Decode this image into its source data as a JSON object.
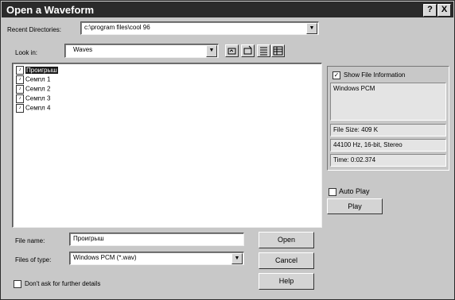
{
  "window": {
    "title": "Open a Waveform",
    "help_btn": "?",
    "close_btn": "X"
  },
  "recent": {
    "label": "Recent Directories:",
    "value": "c:\\program files\\cool 96"
  },
  "lookin": {
    "label": "Look in:",
    "value": "Waves"
  },
  "files": [
    {
      "name": "Проигрыш",
      "selected": true
    },
    {
      "name": "Семпл 1",
      "selected": false
    },
    {
      "name": "Семпл 2",
      "selected": false
    },
    {
      "name": "Семпл 3",
      "selected": false
    },
    {
      "name": "Семпл 4",
      "selected": false
    }
  ],
  "filename": {
    "label": "File name:",
    "value": "Проигрыш"
  },
  "filetype": {
    "label": "Files of type:",
    "value": "Windows PCM (*.wav)"
  },
  "buttons": {
    "open": "Open",
    "cancel": "Cancel",
    "help": "Help"
  },
  "dont_ask": {
    "label": "Don't ask for further details"
  },
  "info": {
    "show_label": "Show File Information",
    "format": "Windows PCM",
    "file_size": "File Size: 409 K",
    "audio": "44100 Hz, 16-bit, Stereo",
    "time": "Time: 0:02.374"
  },
  "autoplay": {
    "label": "Auto Play",
    "play": "Play"
  }
}
